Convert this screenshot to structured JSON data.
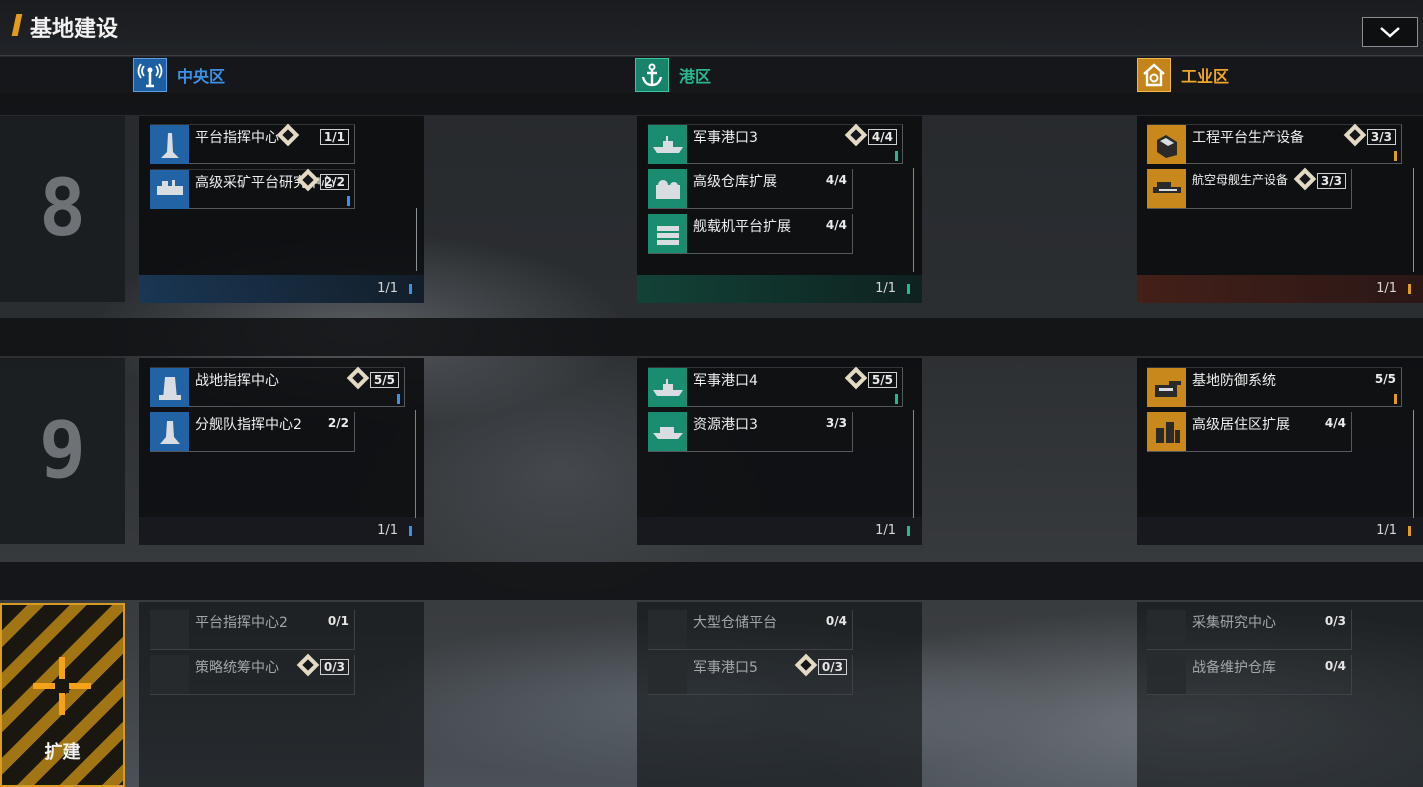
{
  "title": "基地建设",
  "colors": {
    "central": "#2e7fd0",
    "port": "#1fa283",
    "industry": "#e29c22"
  },
  "districts": [
    {
      "label": "中央区",
      "icon": "antenna-icon"
    },
    {
      "label": "港区",
      "icon": "anchor-icon"
    },
    {
      "label": "工业区",
      "icon": "house-gear-icon"
    }
  ],
  "levels": [
    "8",
    "9"
  ],
  "panels": {
    "r8_central": {
      "count": "1/1",
      "items": [
        {
          "name": "平台指挥中心",
          "value": "1/1",
          "star": true
        },
        {
          "name": "高级采矿平台研究中心",
          "value": "2/2",
          "star": true
        }
      ]
    },
    "r8_port": {
      "count": "1/1",
      "items": [
        {
          "name": "军事港口3",
          "value": "4/4",
          "star": true
        },
        {
          "name": "高级仓库扩展",
          "value": "4/4",
          "star": false
        },
        {
          "name": "舰载机平台扩展",
          "value": "4/4",
          "star": false
        }
      ]
    },
    "r8_industry": {
      "count": "1/1",
      "items": [
        {
          "name": "工程平台生产设备",
          "value": "3/3",
          "star": true
        },
        {
          "name": "航空母舰生产设备",
          "value": "3/3",
          "star": true
        }
      ]
    },
    "r9_central": {
      "count": "1/1",
      "items": [
        {
          "name": "战地指挥中心",
          "value": "5/5",
          "star": true
        },
        {
          "name": "分舰队指挥中心2",
          "value": "2/2",
          "star": false
        }
      ]
    },
    "r9_port": {
      "count": "1/1",
      "items": [
        {
          "name": "军事港口4",
          "value": "5/5",
          "star": true
        },
        {
          "name": "资源港口3",
          "value": "3/3",
          "star": false
        }
      ]
    },
    "r9_industry": {
      "count": "1/1",
      "items": [
        {
          "name": "基地防御系统",
          "value": "5/5",
          "star": false
        },
        {
          "name": "高级居住区扩展",
          "value": "4/4",
          "star": false
        }
      ]
    },
    "r10_central": {
      "items": [
        {
          "name": "平台指挥中心2",
          "value": "0/1",
          "star": false
        },
        {
          "name": "策略统筹中心",
          "value": "0/3",
          "star": true
        }
      ]
    },
    "r10_port": {
      "items": [
        {
          "name": "大型仓储平台",
          "value": "0/4",
          "star": false
        },
        {
          "name": "军事港口5",
          "value": "0/3",
          "star": true
        }
      ]
    },
    "r10_industry": {
      "items": [
        {
          "name": "采集研究中心",
          "value": "0/3",
          "star": false
        },
        {
          "name": "战备维护仓库",
          "value": "0/4",
          "star": false
        }
      ]
    }
  },
  "expand_label": "扩建"
}
